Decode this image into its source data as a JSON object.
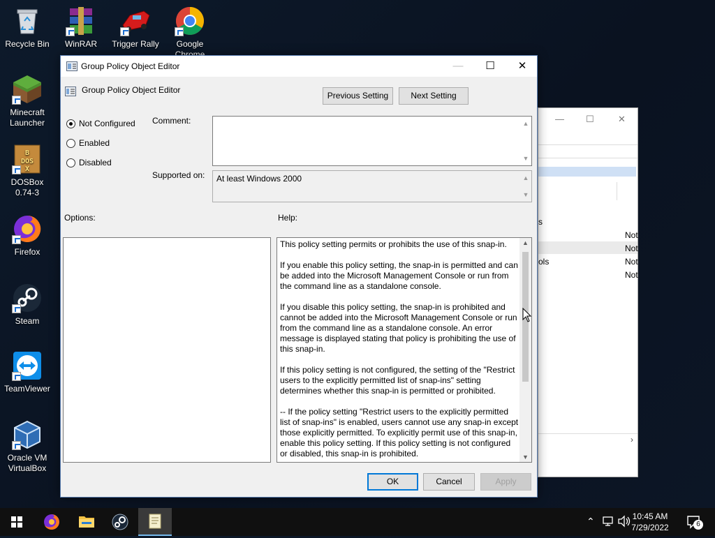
{
  "desktop": {
    "icons": [
      {
        "label": "Recycle Bin"
      },
      {
        "label": "WinRAR"
      },
      {
        "label": "Trigger Rally"
      },
      {
        "label": "Google Chrome"
      },
      {
        "label": "Minecraft Launcher"
      },
      {
        "label": "DOSBox 0.74-3"
      },
      {
        "label": "Firefox"
      },
      {
        "label": "Steam"
      },
      {
        "label": "TeamViewer"
      },
      {
        "label": "Oracle VM VirtualBox"
      }
    ]
  },
  "background_window": {
    "rows": [
      {
        "left": "s",
        "right": "Not"
      },
      {
        "left": "",
        "right": "Not"
      },
      {
        "left": "ols",
        "right": "Not"
      },
      {
        "left": "",
        "right": "Not"
      }
    ]
  },
  "dialog": {
    "title": "Group Policy Object Editor",
    "policy_name": "Group Policy Object Editor",
    "previous_setting_label": "Previous Setting",
    "next_setting_label": "Next Setting",
    "radios": [
      {
        "label": "Not Configured",
        "selected": true
      },
      {
        "label": "Enabled",
        "selected": false
      },
      {
        "label": "Disabled",
        "selected": false
      }
    ],
    "comment_label": "Comment:",
    "comment_value": "",
    "supported_label": "Supported on:",
    "supported_value": "At least Windows 2000",
    "options_label": "Options:",
    "help_label": "Help:",
    "help_paragraphs": [
      "This policy setting permits or prohibits the use of this snap-in.",
      "If you enable this policy setting, the snap-in is permitted and can be added into the Microsoft Management Console or run from the command line as a standalone console.",
      "If you disable this policy setting, the snap-in is prohibited and cannot be added into the Microsoft Management Console or run from the command line as a standalone console. An error message is displayed stating that policy is prohibiting the use of this snap-in.",
      "If this policy setting is not configured, the setting of the \"Restrict users to the explicitly permitted list of snap-ins\" setting determines whether this snap-in is permitted or prohibited.",
      "--  If the policy setting \"Restrict users to the explicitly permitted list of snap-ins\" is enabled, users cannot use any snap-in except those explicitly permitted. To explicitly permit use of this snap-in, enable this policy setting. If this policy setting is not configured or disabled, this snap-in is prohibited."
    ],
    "ok_label": "OK",
    "cancel_label": "Cancel",
    "apply_label": "Apply"
  },
  "taskbar": {
    "time": "10:45 AM",
    "date": "7/29/2022",
    "notification_count": "6"
  },
  "colors": {
    "accent": "#0078d7",
    "taskbar": "#101010",
    "dialog_bg": "#f0f0f0"
  }
}
